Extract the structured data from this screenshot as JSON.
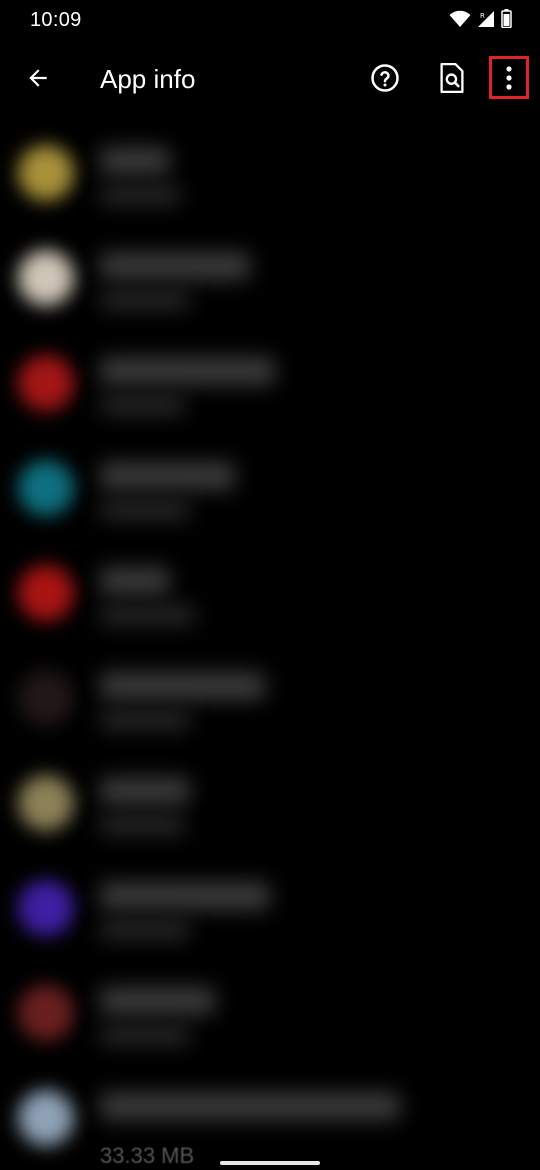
{
  "status": {
    "time": "10:09",
    "wifi_icon": "wifi-icon",
    "signal_icon": "signal-icon",
    "battery_icon": "battery-icon"
  },
  "app_bar": {
    "title": "App info",
    "back_icon": "arrow-back-icon",
    "help_icon": "help-circle-icon",
    "search_doc_icon": "document-search-icon",
    "more_icon": "more-vert-icon",
    "highlight_color": "#e0232a"
  },
  "apps": [
    {
      "color": "#a8913a"
    },
    {
      "color": "#cfc6b8"
    },
    {
      "color": "#a31616"
    },
    {
      "color": "#0f6f80"
    },
    {
      "color": "#a81414"
    },
    {
      "color": "#211717"
    },
    {
      "color": "#8c8157"
    },
    {
      "color": "#3d1fa3"
    },
    {
      "color": "#6a1f1f"
    },
    {
      "color": "#8ea2b6"
    }
  ],
  "footer": {
    "size_text": "33.33 MB"
  }
}
